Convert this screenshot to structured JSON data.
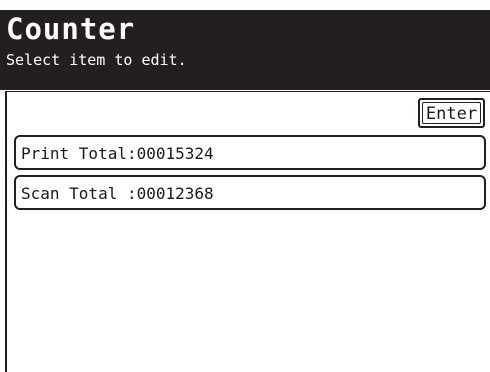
{
  "header": {
    "title": "Counter",
    "subtitle": "Select item to edit."
  },
  "toolbar": {
    "enter_label": "Enter"
  },
  "items": [
    {
      "label": "Print Total:00015324"
    },
    {
      "label": "Scan Total :00012368"
    }
  ],
  "colors": {
    "header_background": "#231f20",
    "header_text": "#ffffff",
    "page_background": "#ffffff",
    "border": "#231f20"
  }
}
